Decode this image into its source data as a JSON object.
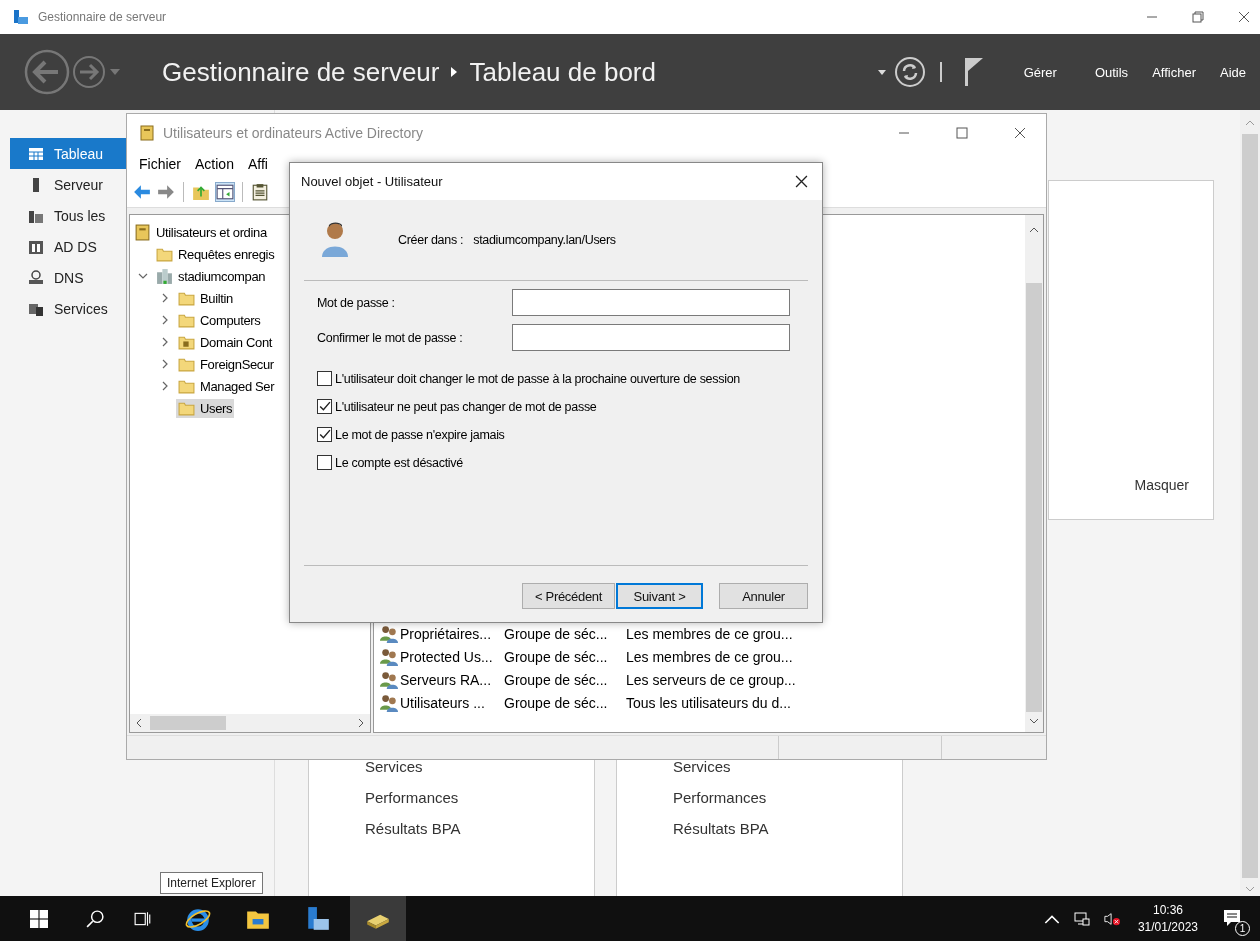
{
  "server_manager": {
    "window_title": "Gestionnaire de serveur",
    "breadcrumb": [
      "Gestionnaire de serveur",
      "Tableau de bord"
    ],
    "menu": [
      "Gérer",
      "Outils",
      "Afficher",
      "Aide"
    ],
    "sidebar": [
      {
        "label": "Tableau",
        "kind": "dashboard",
        "selected": true
      },
      {
        "label": "Serveur",
        "kind": "server",
        "selected": false
      },
      {
        "label": "Tous les",
        "kind": "servers",
        "selected": false
      },
      {
        "label": "AD DS",
        "kind": "adds",
        "selected": false
      },
      {
        "label": "DNS",
        "kind": "dns",
        "selected": false
      },
      {
        "label": "Services",
        "kind": "services",
        "selected": false
      }
    ],
    "welcome_action": "Masquer",
    "tiles": [
      {
        "links": [
          "Services",
          "Performances",
          "Résultats BPA"
        ]
      },
      {
        "links": [
          "Services",
          "Performances",
          "Résultats BPA"
        ]
      }
    ]
  },
  "aduc": {
    "title": "Utilisateurs et ordinateurs Active Directory",
    "menu": [
      "Fichier",
      "Action",
      "Affi"
    ],
    "tree": [
      {
        "label": "Utilisateurs et ordina",
        "kind": "root",
        "selected": false,
        "children": [
          {
            "label": "Requêtes enregis",
            "kind": "folder",
            "selected": false
          },
          {
            "label": "stadiumcompan",
            "kind": "domain",
            "selected": false,
            "expanded": true,
            "children": [
              {
                "label": "Builtin",
                "kind": "folder",
                "selected": false,
                "expanded": false
              },
              {
                "label": "Computers",
                "kind": "folder",
                "selected": false,
                "expanded": false
              },
              {
                "label": "Domain Cont",
                "kind": "ou",
                "selected": false,
                "expanded": false
              },
              {
                "label": "ForeignSecur",
                "kind": "folder",
                "selected": false,
                "expanded": false
              },
              {
                "label": "Managed Ser",
                "kind": "folder",
                "selected": false,
                "expanded": false
              },
              {
                "label": "Users",
                "kind": "folder",
                "selected": true
              }
            ]
          }
        ]
      }
    ],
    "rows": [
      {
        "name": "Propriétaires...",
        "type": "Groupe de séc...",
        "description": "Les membres de ce grou..."
      },
      {
        "name": "Protected Us...",
        "type": "Groupe de séc...",
        "description": "Les membres de ce grou..."
      },
      {
        "name": "Serveurs RA...",
        "type": "Groupe de séc...",
        "description": "Les serveurs de ce group..."
      },
      {
        "name": "Utilisateurs ...",
        "type": "Groupe de séc...",
        "description": "Tous les utilisateurs du d..."
      }
    ]
  },
  "dialog": {
    "title": "Nouvel objet - Utilisateur",
    "create_in_label": "Créer dans :",
    "create_in_path": "stadiumcompany.lan/Users",
    "fields": [
      {
        "label": "Mot de passe :"
      },
      {
        "label": "Confirmer le mot de passe :"
      }
    ],
    "checkboxes": [
      {
        "label": "L'utilisateur doit changer le mot de passe à la prochaine ouverture de session",
        "checked": false
      },
      {
        "label": "L'utilisateur ne peut pas changer de mot de passe",
        "checked": true
      },
      {
        "label": "Le mot de passe n'expire jamais",
        "checked": true
      },
      {
        "label": "Le compte est désactivé",
        "checked": false
      }
    ],
    "buttons": [
      {
        "label": "< Précédent",
        "default": false
      },
      {
        "label": "Suivant >",
        "default": true
      },
      {
        "label": "Annuler",
        "default": false
      }
    ]
  },
  "taskbar": {
    "tooltip": "Internet Explorer",
    "apps": [
      {
        "kind": "ie",
        "active": false
      },
      {
        "kind": "explorer",
        "active": false
      },
      {
        "kind": "server-manager",
        "active": false
      },
      {
        "kind": "aduc",
        "active": true
      }
    ],
    "time": "10:36",
    "date": "31/01/2023",
    "notifications": "1"
  }
}
